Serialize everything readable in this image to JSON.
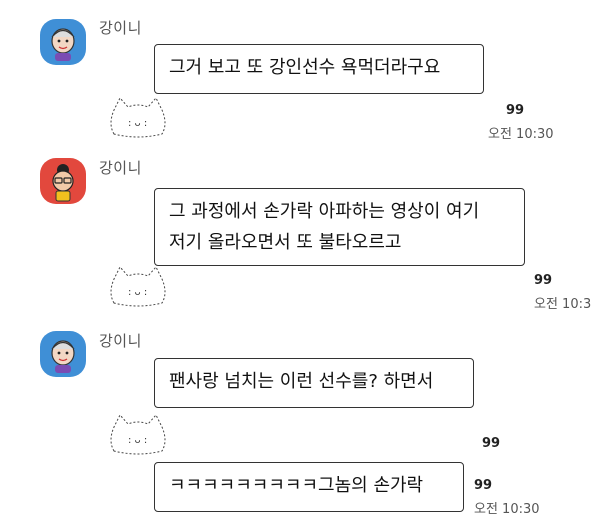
{
  "messages": [
    {
      "sender": "강이니",
      "text": "그거 보고 또 강인선수 욕먹더라구요",
      "read_count": "99",
      "time": "오전 10:30"
    },
    {
      "sender": "강이니",
      "text": "그 과정에서 손가락 아파하는 영상이 여기\n저기 올라오면서 또 불타오르고",
      "read_count": "99",
      "time": "오전 10:3"
    },
    {
      "sender": "강이니",
      "text": "팬사랑 넘치는 이런 선수를? 하면서",
      "read_count": "99",
      "text2": "ㅋㅋㅋㅋㅋㅋㅋㅋㅋ그놈의 손가락",
      "read_count2": "99",
      "time": "오전 10:30"
    }
  ],
  "avatars": [
    "avatar-blue-character",
    "avatar-red-character",
    "avatar-blue-character"
  ],
  "colors": {
    "avatar_blue": "#3f8fd6",
    "avatar_red": "#e2483d",
    "bubble_border": "#333333"
  }
}
